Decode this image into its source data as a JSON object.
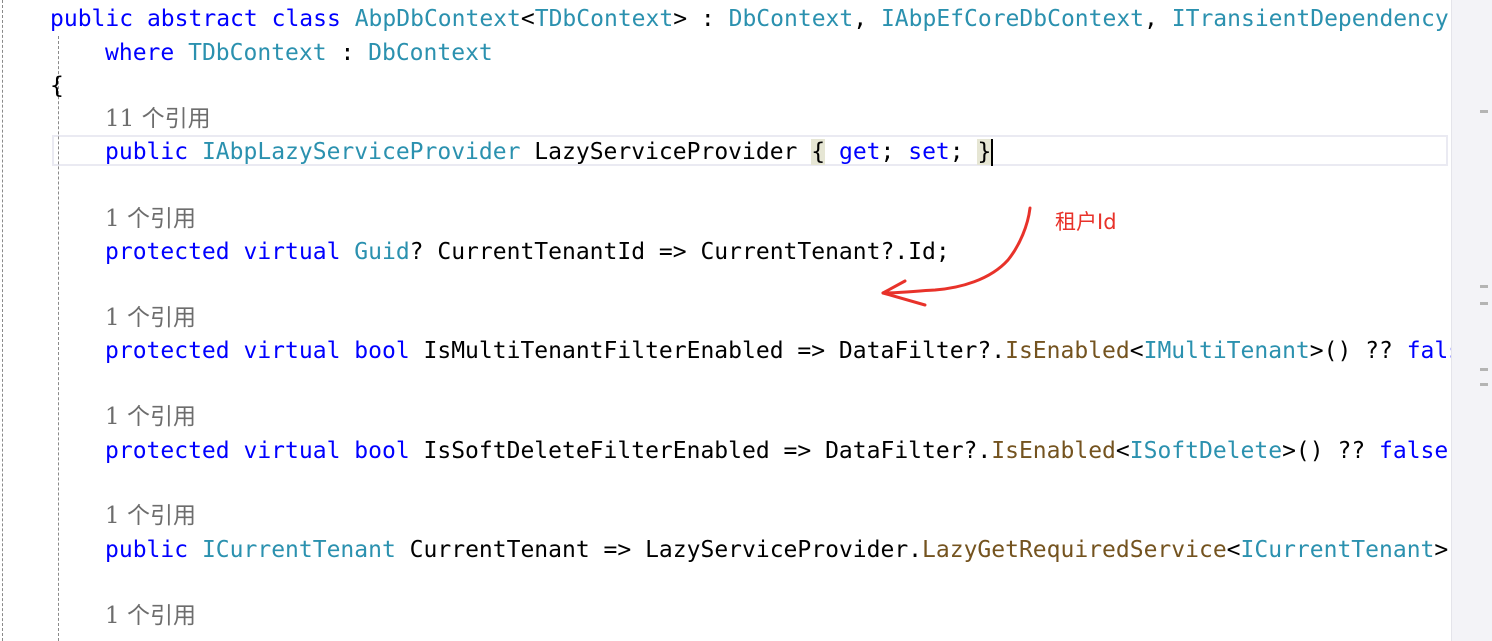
{
  "editor": {
    "lines": [
      {
        "id": "class-decl",
        "parts": [
          {
            "t": "public",
            "c": "kw"
          },
          {
            "t": " ",
            "c": "pl"
          },
          {
            "t": "abstract",
            "c": "kw"
          },
          {
            "t": " ",
            "c": "pl"
          },
          {
            "t": "class",
            "c": "kw"
          },
          {
            "t": " ",
            "c": "pl"
          },
          {
            "t": "AbpDbContext",
            "c": "ty"
          },
          {
            "t": "<",
            "c": "pl"
          },
          {
            "t": "TDbContext",
            "c": "ty"
          },
          {
            "t": "> : ",
            "c": "pl"
          },
          {
            "t": "DbContext",
            "c": "ty"
          },
          {
            "t": ", ",
            "c": "pl"
          },
          {
            "t": "IAbpEfCoreDbContext",
            "c": "ty"
          },
          {
            "t": ", ",
            "c": "pl"
          },
          {
            "t": "ITransientDependency",
            "c": "ty"
          }
        ]
      },
      {
        "id": "where-clause",
        "parts": [
          {
            "t": "where",
            "c": "kw"
          },
          {
            "t": " ",
            "c": "pl"
          },
          {
            "t": "TDbContext",
            "c": "ty"
          },
          {
            "t": " : ",
            "c": "pl"
          },
          {
            "t": "DbContext",
            "c": "ty"
          }
        ]
      },
      {
        "id": "open-brace",
        "parts": [
          {
            "t": "{",
            "c": "pl"
          }
        ]
      },
      {
        "id": "ref-1",
        "ref": true,
        "parts": [
          {
            "t": "11 个引用",
            "c": "ref"
          }
        ]
      },
      {
        "id": "lazy-provider",
        "parts": [
          {
            "t": "public",
            "c": "kw"
          },
          {
            "t": " ",
            "c": "pl"
          },
          {
            "t": "IAbpLazyServiceProvider",
            "c": "ty"
          },
          {
            "t": " LazyServiceProvider ",
            "c": "pl"
          },
          {
            "t": "{",
            "c": "pl brace-hl"
          },
          {
            "t": " ",
            "c": "pl"
          },
          {
            "t": "get",
            "c": "kw"
          },
          {
            "t": "; ",
            "c": "pl"
          },
          {
            "t": "set",
            "c": "kw"
          },
          {
            "t": "; ",
            "c": "pl"
          },
          {
            "t": "}",
            "c": "pl brace-hl"
          }
        ],
        "caret": true
      },
      {
        "id": "ref-2",
        "ref": true,
        "parts": [
          {
            "t": "1 个引用",
            "c": "ref"
          }
        ]
      },
      {
        "id": "tenant-id",
        "parts": [
          {
            "t": "protected",
            "c": "kw"
          },
          {
            "t": " ",
            "c": "pl"
          },
          {
            "t": "virtual",
            "c": "kw"
          },
          {
            "t": " ",
            "c": "pl"
          },
          {
            "t": "Guid",
            "c": "ty"
          },
          {
            "t": "? CurrentTenantId => CurrentTenant?.Id;",
            "c": "pl"
          }
        ]
      },
      {
        "id": "ref-3",
        "ref": true,
        "parts": [
          {
            "t": "1 个引用",
            "c": "ref"
          }
        ]
      },
      {
        "id": "multitenant-filter",
        "parts": [
          {
            "t": "protected",
            "c": "kw"
          },
          {
            "t": " ",
            "c": "pl"
          },
          {
            "t": "virtual",
            "c": "kw"
          },
          {
            "t": " ",
            "c": "pl"
          },
          {
            "t": "bool",
            "c": "kw"
          },
          {
            "t": " IsMultiTenantFilterEnabled => DataFilter?.",
            "c": "pl"
          },
          {
            "t": "IsEnabled",
            "c": "me"
          },
          {
            "t": "<",
            "c": "pl"
          },
          {
            "t": "IMultiTenant",
            "c": "ty"
          },
          {
            "t": ">() ?? ",
            "c": "pl"
          },
          {
            "t": "fals",
            "c": "kw"
          }
        ]
      },
      {
        "id": "ref-4",
        "ref": true,
        "parts": [
          {
            "t": "1 个引用",
            "c": "ref"
          }
        ]
      },
      {
        "id": "softdelete-filter",
        "parts": [
          {
            "t": "protected",
            "c": "kw"
          },
          {
            "t": " ",
            "c": "pl"
          },
          {
            "t": "virtual",
            "c": "kw"
          },
          {
            "t": " ",
            "c": "pl"
          },
          {
            "t": "bool",
            "c": "kw"
          },
          {
            "t": " IsSoftDeleteFilterEnabled => DataFilter?.",
            "c": "pl"
          },
          {
            "t": "IsEnabled",
            "c": "me"
          },
          {
            "t": "<",
            "c": "pl"
          },
          {
            "t": "ISoftDelete",
            "c": "ty"
          },
          {
            "t": ">() ?? ",
            "c": "pl"
          },
          {
            "t": "false",
            "c": "kw"
          },
          {
            "t": ";",
            "c": "pl"
          }
        ]
      },
      {
        "id": "ref-5",
        "ref": true,
        "parts": [
          {
            "t": "1 个引用",
            "c": "ref"
          }
        ]
      },
      {
        "id": "current-tenant",
        "parts": [
          {
            "t": "public",
            "c": "kw"
          },
          {
            "t": " ",
            "c": "pl"
          },
          {
            "t": "ICurrentTenant",
            "c": "ty"
          },
          {
            "t": " CurrentTenant => LazyServiceProvider.",
            "c": "pl"
          },
          {
            "t": "LazyGetRequiredService",
            "c": "me"
          },
          {
            "t": "<",
            "c": "pl"
          },
          {
            "t": "ICurrentTenant",
            "c": "ty"
          },
          {
            "t": ">(",
            "c": "pl"
          }
        ]
      },
      {
        "id": "ref-6",
        "ref": true,
        "parts": [
          {
            "t": "1 个引用",
            "c": "ref"
          }
        ]
      }
    ]
  },
  "annotation": {
    "label": "租户Id",
    "color": "#e8322a"
  },
  "colors": {
    "keyword": "#0000ff",
    "type": "#2b91af",
    "method": "#74531f",
    "reference": "#6d6d6d"
  }
}
